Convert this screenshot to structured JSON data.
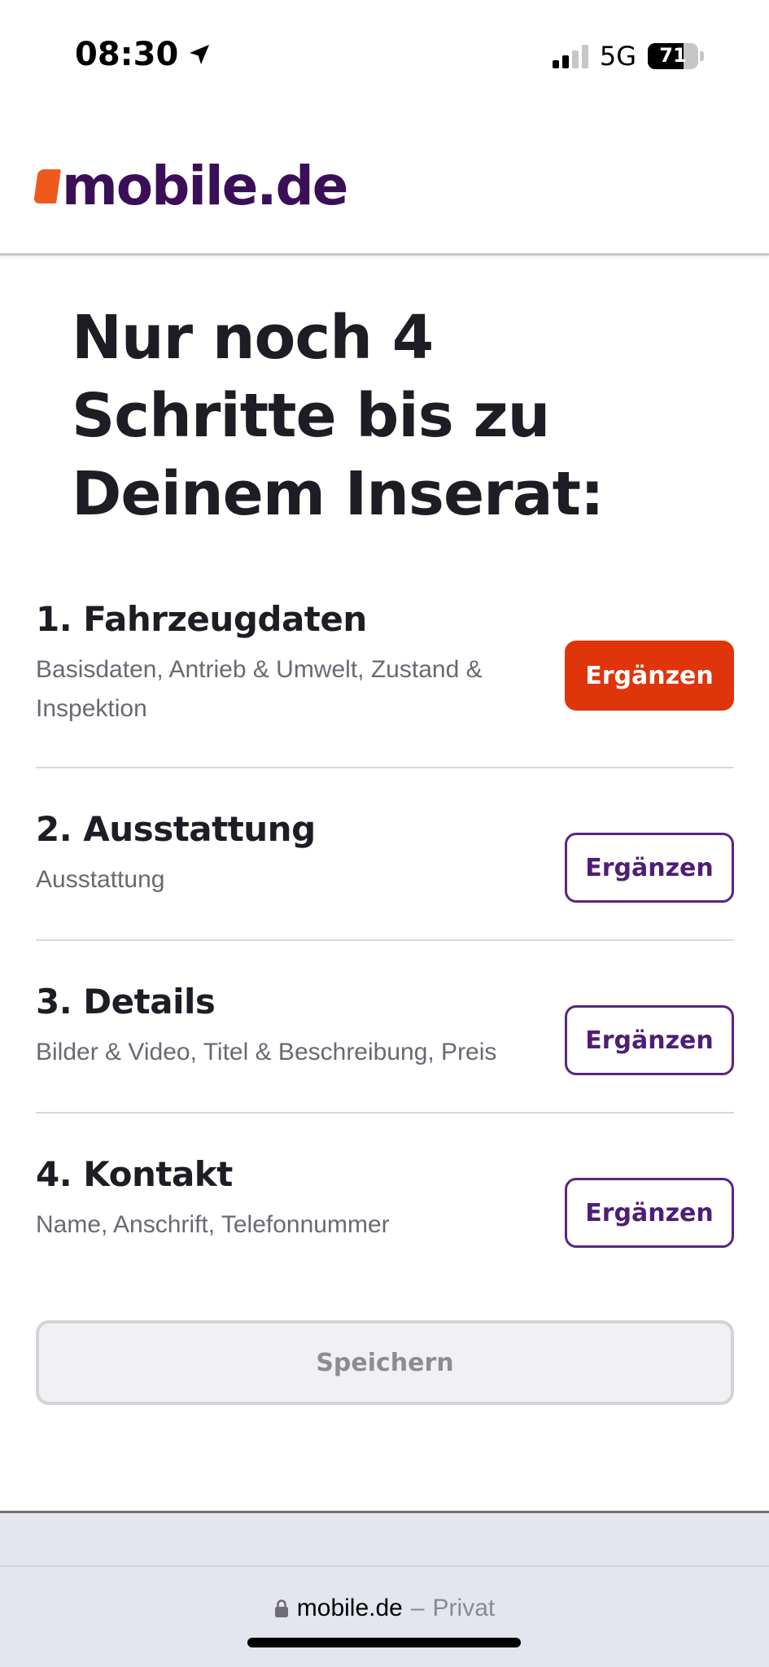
{
  "status_bar": {
    "time": "08:30",
    "network": "5G",
    "battery": "71",
    "battery_level": 0.71,
    "signal_bars_active": 2,
    "signal_bars_total": 4
  },
  "header": {
    "logo_text": "mobile.de",
    "logo_colors": {
      "mark": "#ef5a1c",
      "text": "#3b0f58"
    }
  },
  "main": {
    "headline": "Nur noch 4 Schritte bis zu Deinem Inserat:",
    "steps": [
      {
        "title": "1. Fahrzeugdaten",
        "description": "Basisdaten, Antrieb & Umwelt, Zustand & Inspektion",
        "button": "Ergänzen",
        "style": "primary"
      },
      {
        "title": "2. Ausstattung",
        "description": "Ausstattung",
        "button": "Ergänzen",
        "style": "outline"
      },
      {
        "title": "3. Details",
        "description": "Bilder & Video, Titel & Beschreibung, Preis",
        "button": "Ergänzen",
        "style": "outline"
      },
      {
        "title": "4. Kontakt",
        "description": "Name, Anschrift, Telefonnummer",
        "button": "Ergänzen",
        "style": "outline"
      }
    ],
    "save_label": "Speichern"
  },
  "browser": {
    "domain": "mobile.de",
    "separator": "–",
    "mode": "Privat",
    "lock_icon": "lock-icon"
  },
  "colors": {
    "accent_primary": "#e0340b",
    "accent_outline": "#5a2483",
    "text_dark": "#1f1c25",
    "text_muted": "#6b6872"
  }
}
